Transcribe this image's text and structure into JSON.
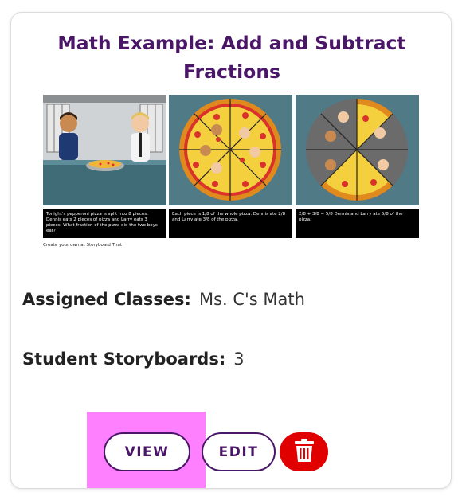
{
  "card": {
    "title_line1": "Math Example: Add and Subtract",
    "title_line2": "Fractions",
    "storyboard": {
      "captions": [
        "Tonight's pepperoni pizza is split into 8 pieces. Dennis eats 2 pieces of pizza and Larry eats 3 pieces. What fraction of the pizza did the two boys eat?",
        "Each piece is 1/8 of the whole pizza. Dennis ate 2/8 and Larry ate 3/8 of the pizza.",
        "2/8 + 3/8 = 5/8 Dennis and Larry ate 5/8 of the pizza."
      ],
      "credit": "Create your own at Storyboard That"
    },
    "assigned_classes_label": "Assigned Classes:",
    "assigned_classes_value": "Ms. C's Math",
    "student_storyboards_label": "Student Storyboards:",
    "student_storyboards_value": "3",
    "view_label": "VIEW",
    "edit_label": "EDIT",
    "delete_icon": "trash-icon",
    "colors": {
      "title": "#4a1668",
      "button_border": "#4a1668",
      "highlight": "#ff80ff",
      "delete": "#e00000",
      "panel_bg": "#4f7a86",
      "pizza_crust": "#f2b53a",
      "pepperoni": "#d8322a"
    }
  }
}
